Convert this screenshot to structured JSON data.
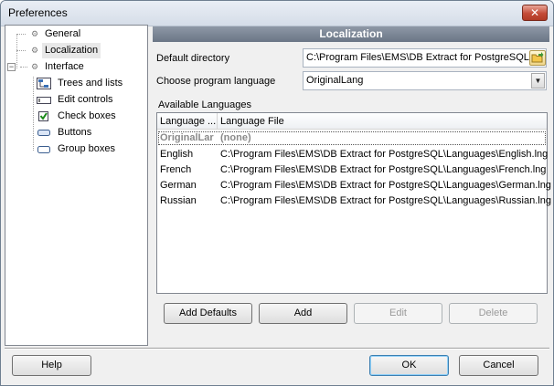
{
  "window": {
    "title": "Preferences",
    "close_glyph": "✕"
  },
  "tree": {
    "items": [
      {
        "label": "General"
      },
      {
        "label": "Localization"
      },
      {
        "label": "Interface"
      },
      {
        "label": "Trees and lists"
      },
      {
        "label": "Edit controls"
      },
      {
        "label": "Check boxes"
      },
      {
        "label": "Buttons"
      },
      {
        "label": "Group boxes"
      }
    ],
    "expander_glyph": "−"
  },
  "panel": {
    "header": "Localization",
    "default_directory_label": "Default directory",
    "default_directory_value": "C:\\Program Files\\EMS\\DB Extract for PostgreSQL\\",
    "language_label": "Choose program language",
    "language_value": "OriginalLang",
    "available_languages_label": "Available Languages"
  },
  "languages_table": {
    "columns": [
      "Language ...",
      "Language File"
    ],
    "default_row": {
      "name": "OriginalLar",
      "file": "(none)"
    },
    "rows": [
      {
        "name": "English",
        "file": "C:\\Program Files\\EMS\\DB Extract for PostgreSQL\\Languages\\English.lng"
      },
      {
        "name": "French",
        "file": "C:\\Program Files\\EMS\\DB Extract for PostgreSQL\\Languages\\French.lng"
      },
      {
        "name": "German",
        "file": "C:\\Program Files\\EMS\\DB Extract for PostgreSQL\\Languages\\German.lng"
      },
      {
        "name": "Russian",
        "file": "C:\\Program Files\\EMS\\DB Extract for PostgreSQL\\Languages\\Russian.lng"
      }
    ]
  },
  "list_buttons": {
    "add_defaults": "Add Defaults",
    "add": "Add",
    "edit": "Edit",
    "delete": "Delete"
  },
  "footer": {
    "help": "Help",
    "ok": "OK",
    "cancel": "Cancel"
  },
  "colors": {
    "header_bg": "#7a8595",
    "close_red": "#c44b37",
    "default_btn_border": "#3c7fb1"
  }
}
